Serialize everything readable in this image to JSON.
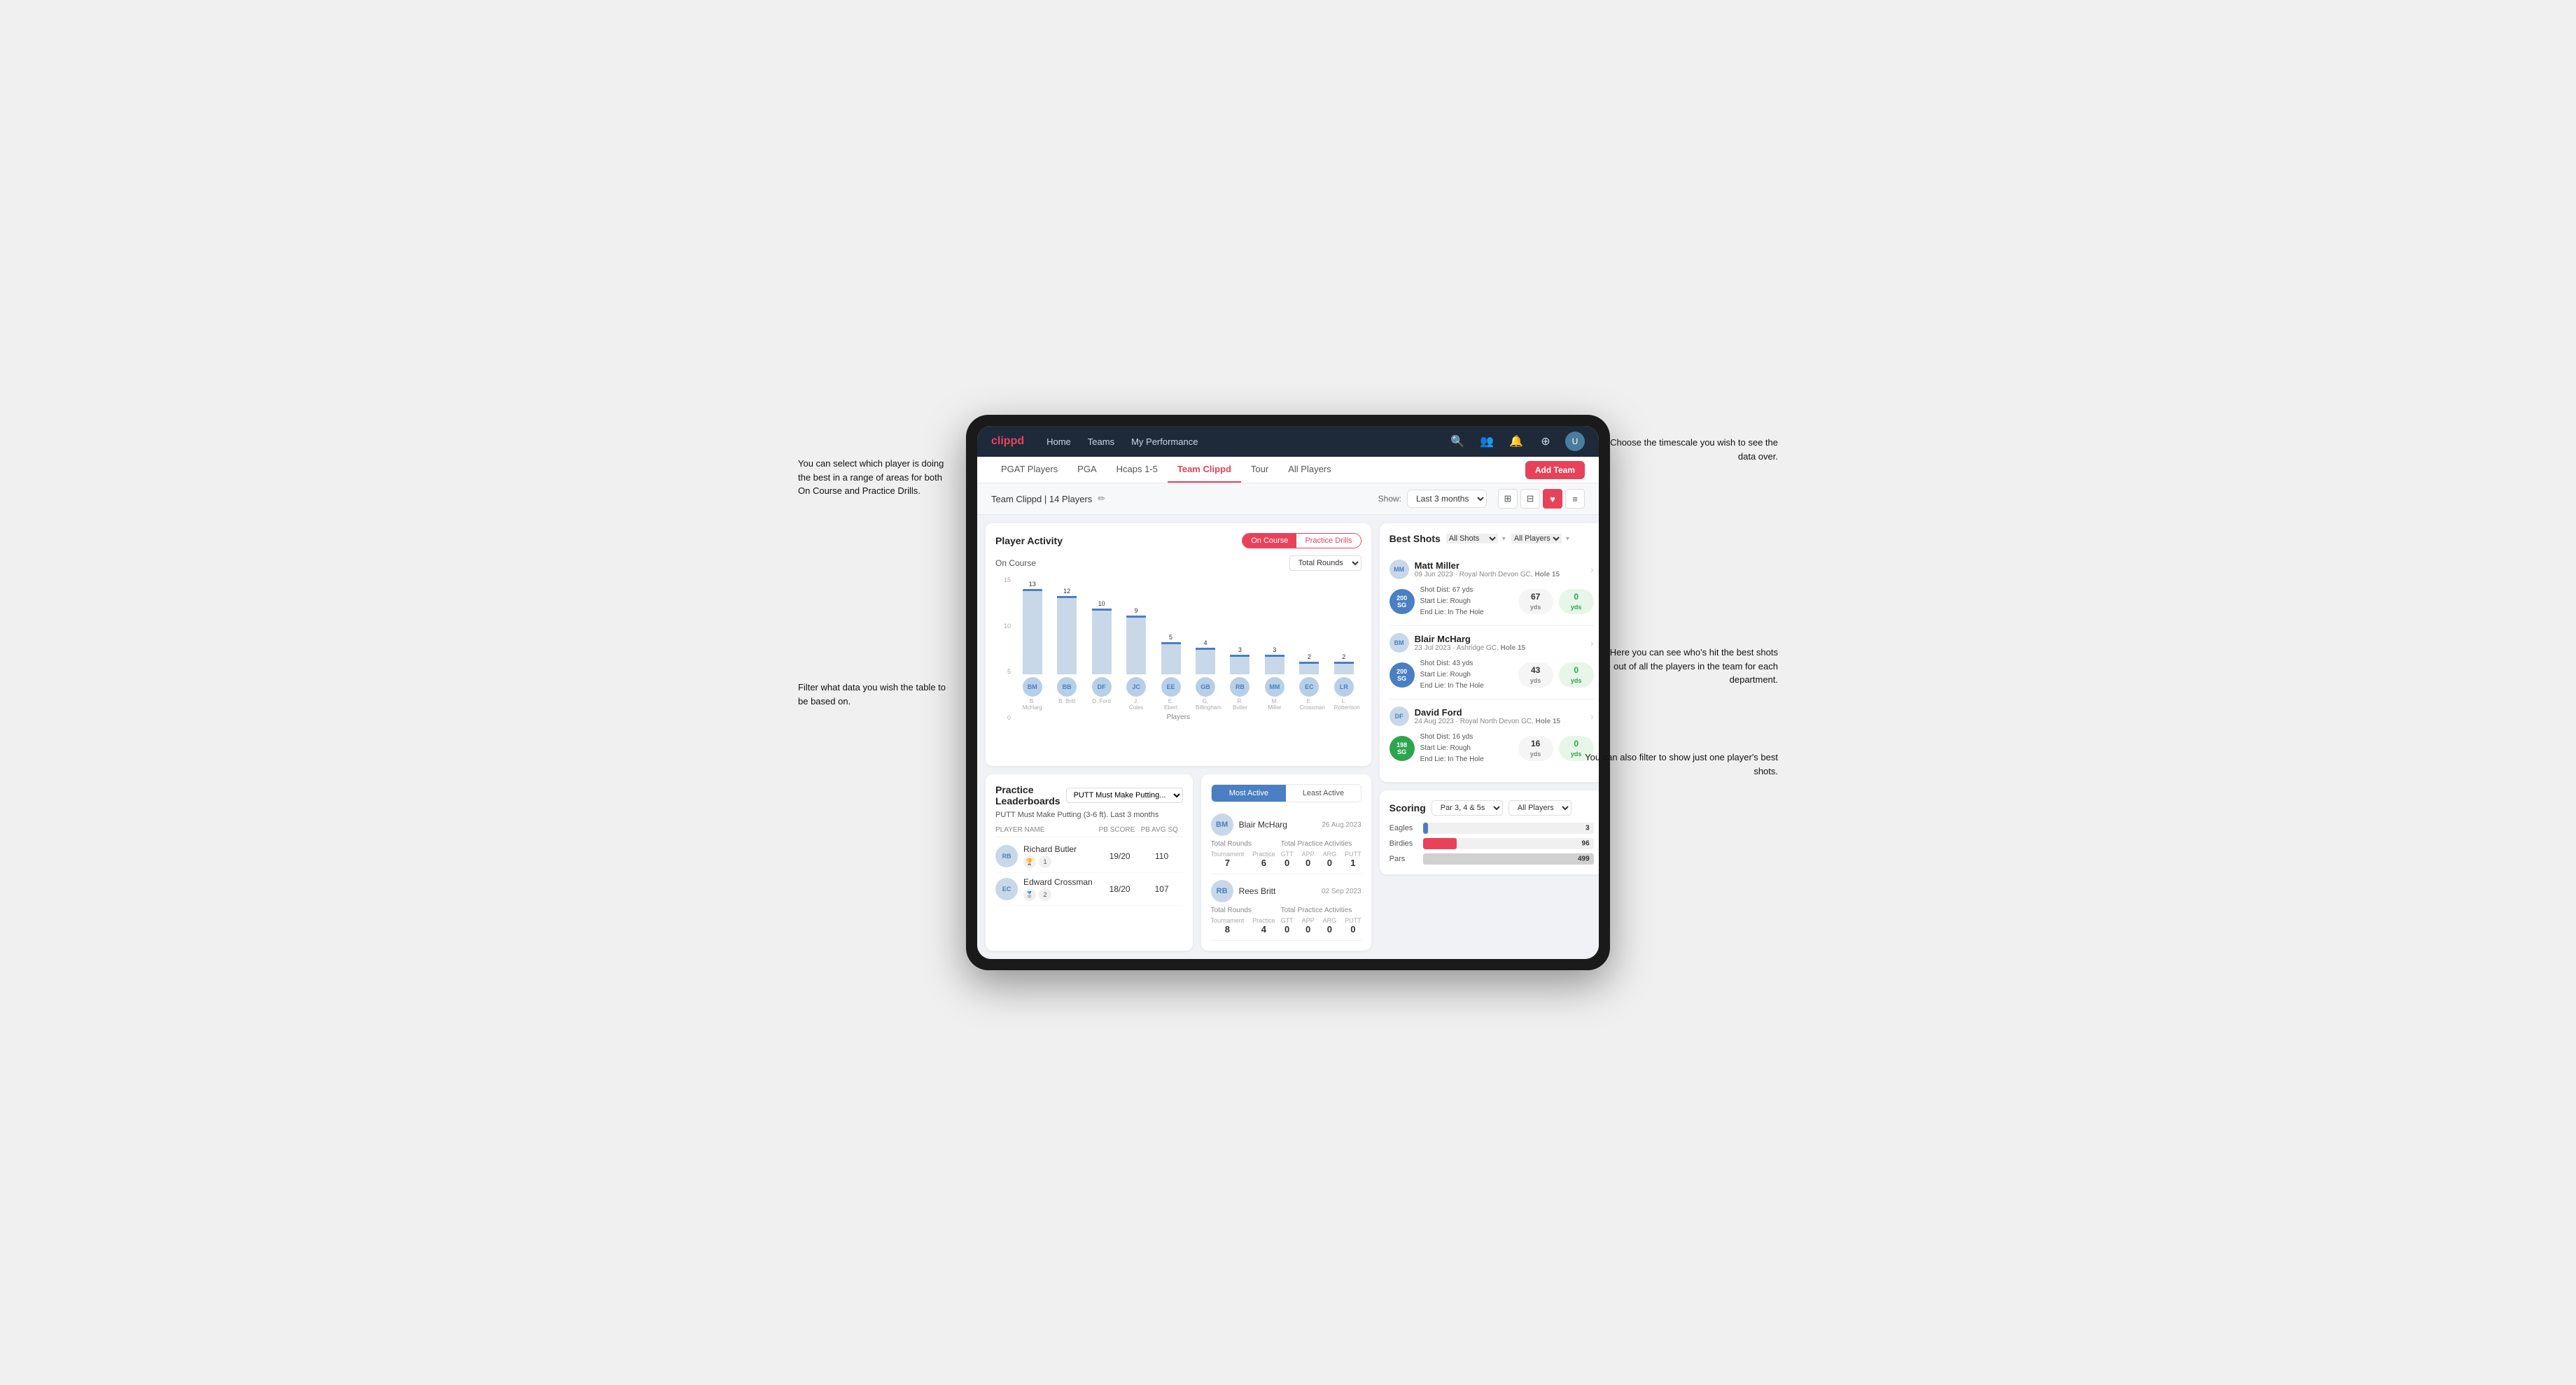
{
  "annotations": {
    "top_left": "You can select which player is doing the best in a range of areas for both On Course and Practice Drills.",
    "bottom_left": "Filter what data you wish the table to be based on.",
    "top_right": "Choose the timescale you wish to see the data over.",
    "mid_right": "Here you can see who's hit the best shots out of all the players in the team for each department.",
    "bottom_right": "You can also filter to show just one player's best shots."
  },
  "nav": {
    "logo": "clippd",
    "items": [
      "Home",
      "Teams",
      "My Performance"
    ],
    "icons": [
      "search",
      "users",
      "bell",
      "circle-plus",
      "avatar"
    ]
  },
  "sub_nav": {
    "items": [
      "PGAT Players",
      "PGA",
      "Hcaps 1-5",
      "Team Clippd",
      "Tour",
      "All Players"
    ],
    "active": "Team Clippd",
    "add_button": "Add Team"
  },
  "team_header": {
    "team_name": "Team Clippd | 14 Players",
    "show_label": "Show:",
    "timescale": "Last 3 months",
    "view_icons": [
      "grid-2",
      "grid-3",
      "heart",
      "settings"
    ]
  },
  "player_activity": {
    "title": "Player Activity",
    "toggle_oncourse": "On Course",
    "toggle_practice": "Practice Drills",
    "active_toggle": "On Course",
    "section_title": "On Course",
    "chart_dropdown": "Total Rounds",
    "x_axis_title": "Players",
    "y_labels": [
      "15",
      "10",
      "5",
      "0"
    ],
    "bars": [
      {
        "player": "B. McHarg",
        "value": 13,
        "initials": "BM",
        "color": "#b8cfe0"
      },
      {
        "player": "B. Britt",
        "value": 12,
        "initials": "BB",
        "color": "#b8cfe0"
      },
      {
        "player": "D. Ford",
        "value": 10,
        "initials": "DF",
        "color": "#b8cfe0"
      },
      {
        "player": "J. Coles",
        "value": 9,
        "initials": "JC",
        "color": "#b8cfe0"
      },
      {
        "player": "E. Ebert",
        "value": 5,
        "initials": "EE",
        "color": "#b8cfe0"
      },
      {
        "player": "G. Billingham",
        "value": 4,
        "initials": "GB",
        "color": "#b8cfe0"
      },
      {
        "player": "R. Butler",
        "value": 3,
        "initials": "RB",
        "color": "#b8cfe0"
      },
      {
        "player": "M. Miller",
        "value": 3,
        "initials": "MM",
        "color": "#b8cfe0"
      },
      {
        "player": "E. Crossman",
        "value": 2,
        "initials": "EC",
        "color": "#b8cfe0"
      },
      {
        "player": "L. Robertson",
        "value": 2,
        "initials": "LR",
        "color": "#b8cfe0"
      }
    ]
  },
  "practice_leaderboard": {
    "title": "Practice Leaderboards",
    "drill_name": "PUTT Must Make Putting...",
    "drill_full": "PUTT Must Make Putting (3-6 ft). Last 3 months",
    "columns": [
      "PLAYER NAME",
      "PB SCORE",
      "PB AVG SQ"
    ],
    "rows": [
      {
        "rank": 1,
        "name": "Richard Butler",
        "initials": "RB",
        "pb_score": "19/20",
        "pb_avg": "110"
      },
      {
        "rank": 2,
        "name": "Edward Crossman",
        "initials": "EC",
        "pb_score": "18/20",
        "pb_avg": "107"
      }
    ]
  },
  "most_active": {
    "toggle_most": "Most Active",
    "toggle_least": "Least Active",
    "players": [
      {
        "name": "Blair McHarg",
        "date": "26 Aug 2023",
        "total_rounds_label": "Total Rounds",
        "tournament": "7",
        "practice": "6",
        "practice_activities_label": "Total Practice Activities",
        "gtt": "0",
        "app": "0",
        "arg": "0",
        "putt": "1"
      },
      {
        "name": "Rees Britt",
        "date": "02 Sep 2023",
        "total_rounds_label": "Total Rounds",
        "tournament": "8",
        "practice": "4",
        "practice_activities_label": "Total Practice Activities",
        "gtt": "0",
        "app": "0",
        "arg": "0",
        "putt": "0"
      }
    ]
  },
  "best_shots": {
    "title": "Best Shots",
    "filter1": "All Shots",
    "filter2": "All Players",
    "shots": [
      {
        "player": "Matt Miller",
        "date": "09 Jun 2023",
        "course": "Royal North Devon GC",
        "hole": "Hole 15",
        "badge_text": "200",
        "badge_sub": "SG",
        "badge_color": "blue",
        "shot_dist": "Shot Dist: 67 yds",
        "start_lie": "Start Lie: Rough",
        "end_lie": "End Lie: In The Hole",
        "yds_val": "67",
        "zero_val": "0"
      },
      {
        "player": "Blair McHarg",
        "date": "23 Jul 2023",
        "course": "Ashridge GC",
        "hole": "Hole 15",
        "badge_text": "200",
        "badge_sub": "SG",
        "badge_color": "blue",
        "shot_dist": "Shot Dist: 43 yds",
        "start_lie": "Start Lie: Rough",
        "end_lie": "End Lie: In The Hole",
        "yds_val": "43",
        "zero_val": "0"
      },
      {
        "player": "David Ford",
        "date": "24 Aug 2023",
        "course": "Royal North Devon GC",
        "hole": "Hole 15",
        "badge_text": "198",
        "badge_sub": "SG",
        "badge_color": "green",
        "shot_dist": "Shot Dist: 16 yds",
        "start_lie": "Start Lie: Rough",
        "end_lie": "End Lie: In The Hole",
        "yds_val": "16",
        "zero_val": "0"
      }
    ]
  },
  "scoring": {
    "title": "Scoring",
    "filter1": "Par 3, 4 & 5s",
    "filter2": "All Players",
    "rows": [
      {
        "label": "Eagles",
        "value": 3,
        "max": 100,
        "color": "#4a7fc1",
        "width_pct": 3
      },
      {
        "label": "Birdies",
        "value": 96,
        "max": 499,
        "color": "#e8425a",
        "width_pct": 19
      },
      {
        "label": "Pars",
        "value": 499,
        "max": 499,
        "color": "#c8c8c8",
        "width_pct": 100
      }
    ]
  }
}
